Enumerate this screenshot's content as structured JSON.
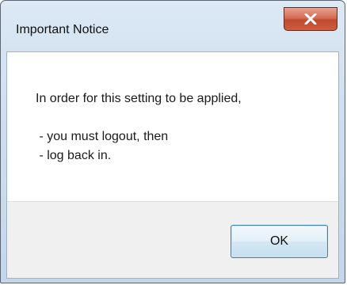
{
  "window": {
    "title": "Important Notice"
  },
  "message": {
    "line1": "In order for this setting to be applied,",
    "line2": " - you must logout, then",
    "line3": " - log back in."
  },
  "buttons": {
    "ok_label": "OK",
    "close_icon": "close-x-icon"
  },
  "colors": {
    "close_button": "#c94f33",
    "ok_border": "#3c7fb1",
    "frame": "#cfdff0"
  }
}
